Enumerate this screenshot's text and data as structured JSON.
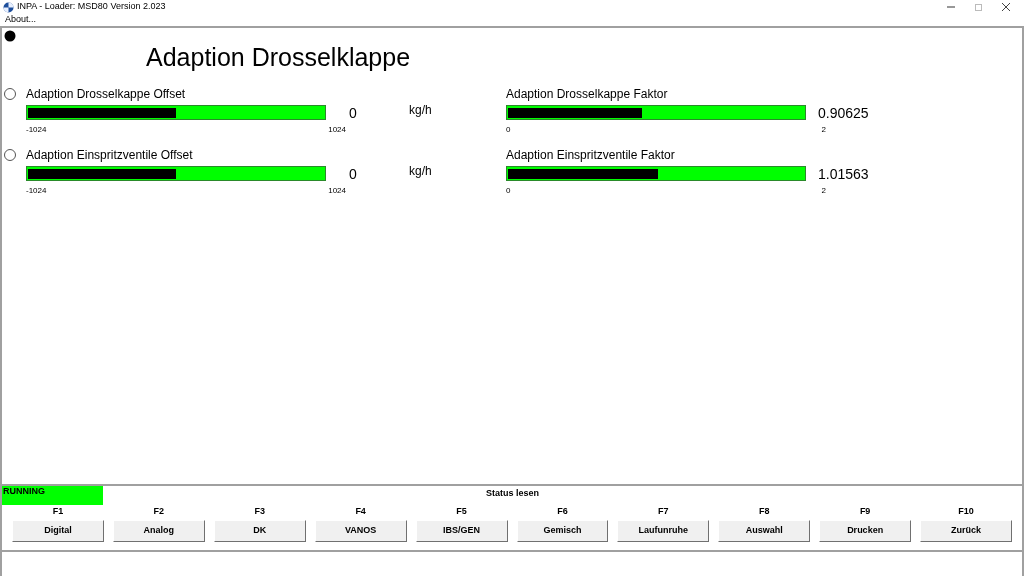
{
  "window": {
    "title": "INPA - Loader:  MSD80 Version 2.023"
  },
  "menu": [
    "About..."
  ],
  "title": "Adaption Drosselklappe",
  "rows": [
    {
      "selected": false,
      "meters": [
        {
          "label": "Adaption Drosselkappe Offset",
          "level": 0.5,
          "min": "-1024",
          "max": "1024",
          "reading": "0",
          "unit": "kg/h"
        },
        {
          "label": "Adaption Drosselkappe Faktor",
          "level": 0.453,
          "min": "0",
          "max": "2",
          "reading": "0.90625"
        }
      ]
    },
    {
      "selected": false,
      "meters": [
        {
          "label": "Adaption Einspritzventile Offset",
          "level": 0.5,
          "min": "-1024",
          "max": "1024",
          "reading": "0",
          "unit": "kg/h"
        },
        {
          "label": "Adaption Einspritzventile Faktor",
          "level": 0.508,
          "min": "0",
          "max": "2",
          "reading": "1.01563"
        }
      ]
    }
  ],
  "status": {
    "text": "RUNNING",
    "color": "#00ff00"
  },
  "status_title": "Status lesen",
  "function_keys": [
    {
      "key": "F1",
      "label": "Digital"
    },
    {
      "key": "F2",
      "label": "Analog"
    },
    {
      "key": "F3",
      "label": "DK"
    },
    {
      "key": "F4",
      "label": "VANOS"
    },
    {
      "key": "F5",
      "label": "IBS/GEN"
    },
    {
      "key": "F6",
      "label": "Gemisch"
    },
    {
      "key": "F7",
      "label": "Laufunruhe"
    },
    {
      "key": "F8",
      "label": "Auswahl"
    },
    {
      "key": "F9",
      "label": "Drucken"
    },
    {
      "key": "F10",
      "label": "Zurück"
    }
  ]
}
